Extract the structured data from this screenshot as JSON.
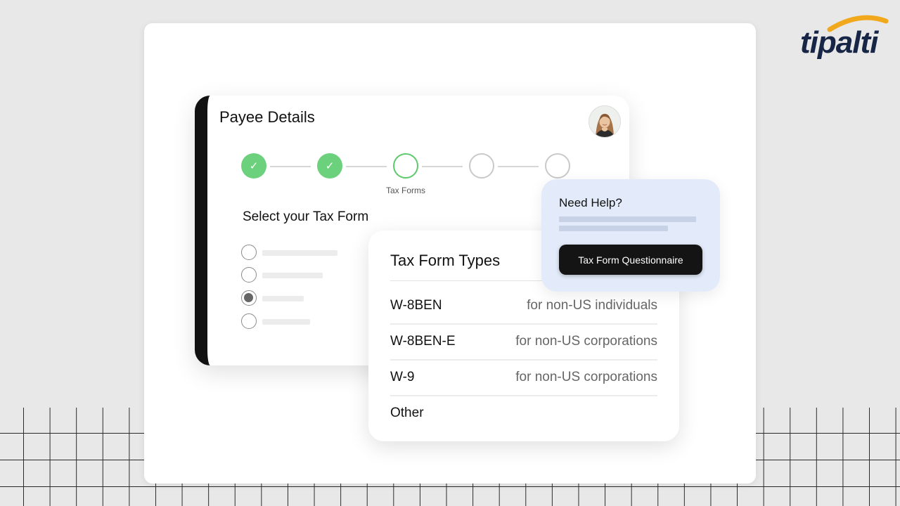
{
  "brand": {
    "logo_text": "tipalti",
    "accent": "#f2a81d",
    "navy": "#172547"
  },
  "payee": {
    "title": "Payee Details",
    "steps": [
      {
        "state": "done",
        "label": ""
      },
      {
        "state": "done",
        "label": ""
      },
      {
        "state": "active",
        "label": "Tax Forms"
      },
      {
        "state": "todo",
        "label": ""
      },
      {
        "state": "todo",
        "label": ""
      }
    ],
    "current_step_label": "Tax Forms",
    "select_title": "Select your Tax Form",
    "radio_options_selected_index": 2
  },
  "tax_form_types": {
    "title": "Tax Form Types",
    "rows": [
      {
        "name": "W-8BEN",
        "desc": "for non-US individuals"
      },
      {
        "name": "W-8BEN-E",
        "desc": "for non-US corporations"
      },
      {
        "name": "W-9",
        "desc": "for non-US corporations"
      },
      {
        "name": "Other",
        "desc": ""
      }
    ]
  },
  "help": {
    "title": "Need Help?",
    "button_label": "Tax Form Questionnaire"
  },
  "colors": {
    "step_done": "#6cd17c",
    "step_active_border": "#5cc96c",
    "help_bg": "#e3ebfa",
    "button_bg": "#141414"
  }
}
